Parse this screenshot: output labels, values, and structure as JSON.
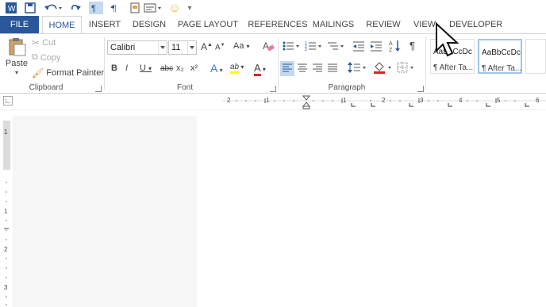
{
  "qat": {
    "word_icon": "W",
    "save_icon": "save-icon",
    "undo_icon": "undo-icon",
    "redo_icon": "redo-icon",
    "smiley": "☺",
    "more": "▾"
  },
  "tabs": [
    {
      "label": "FILE"
    },
    {
      "label": "HOME"
    },
    {
      "label": "INSERT"
    },
    {
      "label": "DESIGN"
    },
    {
      "label": "PAGE LAYOUT"
    },
    {
      "label": "REFERENCES"
    },
    {
      "label": "MAILINGS"
    },
    {
      "label": "REVIEW"
    },
    {
      "label": "VIEW"
    },
    {
      "label": "DEVELOPER"
    }
  ],
  "clipboard": {
    "paste_label": "Paste",
    "cut_label": "Cut",
    "copy_label": "Copy",
    "format_painter_label": "Format Painter",
    "group_label": "Clipboard"
  },
  "font": {
    "font_name": "Calibri",
    "font_size": "11",
    "grow": "A",
    "shrink": "A",
    "case": "Aa",
    "bold": "B",
    "italic": "I",
    "underline": "U",
    "strike": "abc",
    "subscript": "x₂",
    "superscript": "x²",
    "text_effects": "A",
    "highlight": "ab",
    "font_color": "A",
    "group_label": "Font"
  },
  "paragraph": {
    "group_label": "Paragraph",
    "pilcrow": "¶"
  },
  "styles": [
    {
      "preview": "AaBbCcDc",
      "name": "¶ After Ta..."
    },
    {
      "preview": "AaBbCcDc",
      "name": "¶ After Ta..."
    }
  ],
  "ruler": {
    "numbers": [
      "2",
      "1",
      "1",
      "2",
      "3",
      "4",
      "5",
      "6"
    ]
  },
  "vruler": {
    "numbers": [
      "1",
      "1",
      "2",
      "3"
    ]
  },
  "colors": {
    "accent": "#2b579a",
    "highlight": "#ffff00",
    "font_color": "#e02020"
  }
}
